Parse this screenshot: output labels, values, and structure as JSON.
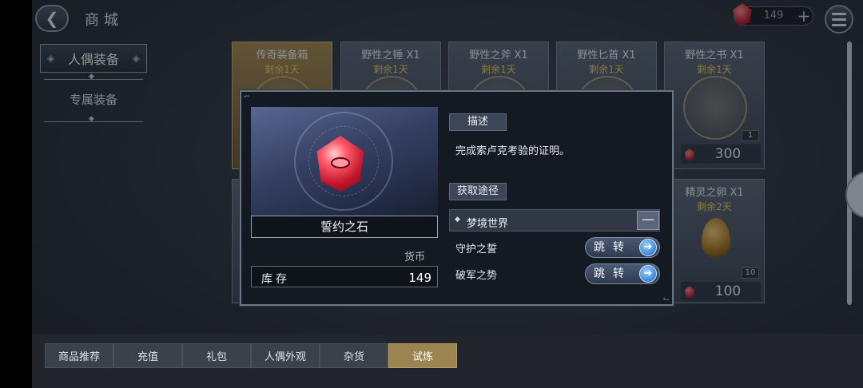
{
  "header": {
    "title": "商城",
    "currency_count": "149",
    "currency_plus": "+"
  },
  "side_nav": {
    "active": "人偶装备",
    "other": "专属装备"
  },
  "shop_cards": [
    {
      "name": "传奇装备箱",
      "days": "剩余1天"
    },
    {
      "name": "野性之锤 X1",
      "days": "剩余1天"
    },
    {
      "name": "野性之斧 X1",
      "days": "剩余1天"
    },
    {
      "name": "野性匕首 X1",
      "days": "剩余1天"
    },
    {
      "name": "野性之书 X1",
      "days": "剩余1天",
      "qty": "1",
      "price": "300"
    },
    {
      "name": "精灵之卵 X1",
      "days": "剩余2天",
      "qty": "10",
      "price": "100"
    }
  ],
  "popup": {
    "item_name": "誓约之石",
    "currency_label": "货币",
    "stock_label": "库存",
    "stock_value": "149",
    "desc_header": "描述",
    "desc_text": "完成索卢克考验的证明。",
    "source_header": "获取途径",
    "source_group": "梦境世界",
    "collapse": "—",
    "sources": [
      {
        "name": "守护之誓",
        "action": "跳转"
      },
      {
        "name": "破军之势",
        "action": "跳转"
      }
    ]
  },
  "bottom_tabs": [
    "商品推荐",
    "充值",
    "礼包",
    "人偶外观",
    "杂货",
    "试炼"
  ],
  "colors": {
    "accent_gold": "#9c8451",
    "gem_red": "#c3162c",
    "days_yellow": "#f3cc5a"
  }
}
